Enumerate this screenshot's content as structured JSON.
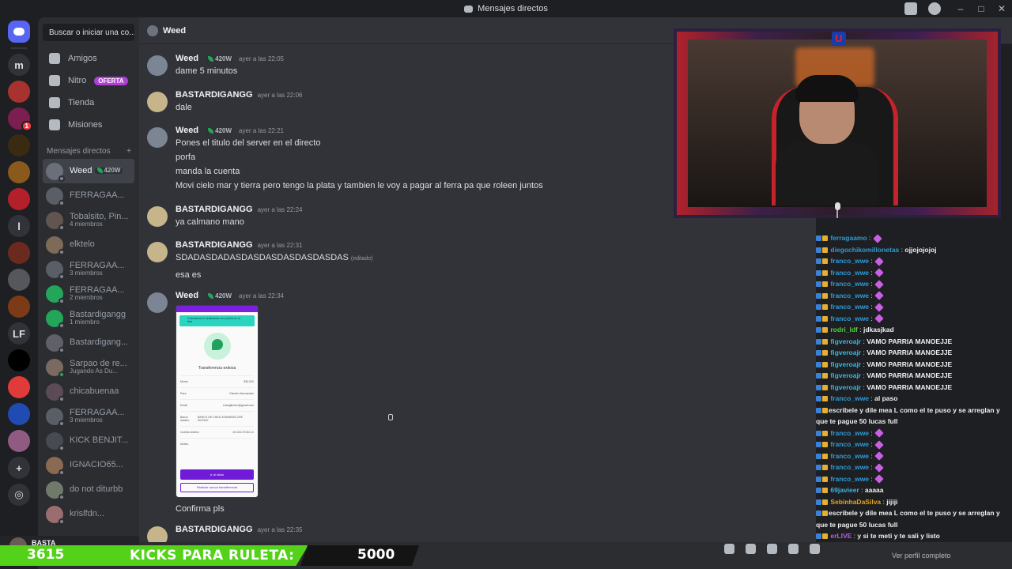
{
  "window": {
    "title": "Mensajes directos"
  },
  "rail": {
    "servers": [
      {
        "label": "",
        "kind": "home",
        "color": "#5865f2"
      },
      {
        "label": "m",
        "kind": "letter",
        "color": "#313338"
      },
      {
        "label": "",
        "kind": "img",
        "color": "#a8322d"
      },
      {
        "label": "",
        "kind": "img",
        "color": "#7a1f4f",
        "badge": "1"
      },
      {
        "label": "",
        "kind": "img",
        "color": "#3a2a12"
      },
      {
        "label": "",
        "kind": "img",
        "color": "#8a5a1c"
      },
      {
        "label": "",
        "kind": "img",
        "color": "#b3202a"
      },
      {
        "label": "l",
        "kind": "letter",
        "color": "#313338"
      },
      {
        "label": "",
        "kind": "img",
        "color": "#6b2a1f"
      },
      {
        "label": "",
        "kind": "img",
        "color": "#55575d"
      },
      {
        "label": "",
        "kind": "img",
        "color": "#7b3b16"
      },
      {
        "label": "LF",
        "kind": "letter",
        "color": "#313338"
      },
      {
        "label": "",
        "kind": "img",
        "color": "#000000"
      },
      {
        "label": "",
        "kind": "img",
        "color": "#e03a3a"
      },
      {
        "label": "",
        "kind": "img",
        "color": "#1f4bb3"
      },
      {
        "label": "",
        "kind": "img",
        "color": "#8f5b82"
      }
    ]
  },
  "sidebar": {
    "search_placeholder": "Buscar o iniciar una co...",
    "nav": [
      {
        "label": "Amigos",
        "icon": "friends-icon"
      },
      {
        "label": "Nitro",
        "icon": "nitro-icon",
        "badge": "OFERTA"
      },
      {
        "label": "Tienda",
        "icon": "shop-icon"
      },
      {
        "label": "Misiones",
        "icon": "quests-icon"
      }
    ],
    "dm_header": "Mensajes directos",
    "dms": [
      {
        "name": "Weed",
        "sub": "",
        "tag": "420W",
        "active": true,
        "color": "#6a6f7a",
        "online": false
      },
      {
        "name": "FERRAGAA...",
        "sub": "",
        "color": "#5a5e66",
        "online": false
      },
      {
        "name": "Tobalsito, Pin...",
        "sub": "4 miembros",
        "color": "#62554f",
        "online": false
      },
      {
        "name": "elktelo",
        "sub": "",
        "color": "#7d6b58",
        "online": false
      },
      {
        "name": "FERRAGAA...",
        "sub": "3 miembros",
        "color": "#5a5e66",
        "online": false
      },
      {
        "name": "FERRAGAA...",
        "sub": "2 miembros",
        "color": "#23a55a",
        "online": false
      },
      {
        "name": "Bastardigangg",
        "sub": "1 miembro",
        "color": "#23a55a",
        "online": false
      },
      {
        "name": "Bastardigang...",
        "sub": "",
        "color": "#5f6068",
        "online": false
      },
      {
        "name": "Sarpao de re...",
        "sub": "Jugando As Du...",
        "color": "#7a6a5f",
        "online": true
      },
      {
        "name": "chicabuenaa",
        "sub": "",
        "color": "#5c4a56",
        "online": false
      },
      {
        "name": "FERRAGAA...",
        "sub": "3 miembros",
        "color": "#5a5e66",
        "online": false
      },
      {
        "name": "KICK BENJIT...",
        "sub": "",
        "color": "#474a50",
        "online": false
      },
      {
        "name": "IGNACIO65...",
        "sub": "",
        "color": "#8a6a52",
        "online": false
      },
      {
        "name": "do not diturbb",
        "sub": "",
        "color": "#6f7a6b",
        "online": false
      },
      {
        "name": "krislfdn...",
        "sub": "",
        "color": "#9a6d70",
        "online": false
      }
    ]
  },
  "chat_header": {
    "name": "Weed"
  },
  "messages": [
    {
      "author": "Weed",
      "tag": "420W",
      "time": "ayer a las 22:05",
      "color": "#7b8593",
      "lines": [
        "dame 5 minutos"
      ]
    },
    {
      "author": "BASTARDIGANGG",
      "tag": "",
      "time": "ayer a las 22:06",
      "color": "#c6b48b",
      "lines": [
        "dale"
      ]
    },
    {
      "author": "Weed",
      "tag": "420W",
      "time": "ayer a las 22:21",
      "color": "#7b8593",
      "lines": [
        "Pones el titulo del server en el directo",
        "porfa",
        "manda la cuenta",
        "Movi cielo mar y tierra pero tengo la plata y tambien le voy a pagar al ferra pa que roleen juntos"
      ]
    },
    {
      "author": "BASTARDIGANGG",
      "tag": "",
      "time": "ayer a las 22:24",
      "color": "#c6b48b",
      "lines": [
        "ya calmano mano"
      ]
    },
    {
      "author": "BASTARDIGANGG",
      "tag": "",
      "time": "ayer a las 22:31",
      "color": "#c6b48b",
      "lines": [
        "SDADASDADASDASDASDASDASDASDAS",
        "esa es"
      ],
      "edited": "(editado)"
    },
    {
      "author": "Weed",
      "tag": "420W",
      "time": "ayer a las 22:34",
      "color": "#7b8593",
      "lines": [],
      "after": "Confirma pls"
    },
    {
      "author": "BASTARDIGANGG",
      "tag": "",
      "time": "ayer a las 22:35",
      "color": "#c6b48b",
      "lines": []
    }
  ],
  "receipt": {
    "banner": "Guardamos el destinatario así podrás en tu lista.",
    "title": "Transferencia exitosa",
    "rows": [
      {
        "k": "Monto",
        "v": "$30.000"
      },
      {
        "k": "Para",
        "v": "Claudio Hermandaz"
      },
      {
        "k": "Email",
        "v": "extragltmero@gmail.com"
      },
      {
        "k": "Banco destino",
        "v": "BANCO DE CHILE-EDWARDS-CRE DICHILE"
      },
      {
        "k": "Cuenta destino",
        "v": "00-024-97242-11"
      },
      {
        "k": "Motivo",
        "v": ""
      }
    ],
    "btn_primary": "Ir al inicio",
    "btn_secondary": "Realizar nueva transferencia"
  },
  "stream_chat": [
    {
      "user": "ferragaamo",
      "msg": "",
      "color": "#2e9bd6",
      "emote": true
    },
    {
      "user": "diegochikomillonetas",
      "msg": "ojjojojojoj",
      "color": "#2e9bd6",
      "emote": false
    },
    {
      "user": "franco_wwe",
      "msg": "",
      "color": "#2e9bd6",
      "emote": true
    },
    {
      "user": "franco_wwe",
      "msg": "",
      "color": "#2e9bd6",
      "emote": true
    },
    {
      "user": "franco_wwe",
      "msg": "",
      "color": "#2e9bd6",
      "emote": true
    },
    {
      "user": "franco_wwe",
      "msg": "",
      "color": "#2e9bd6",
      "emote": true
    },
    {
      "user": "franco_wwe",
      "msg": "",
      "color": "#2e9bd6",
      "emote": true
    },
    {
      "user": "franco_wwe",
      "msg": "",
      "color": "#2e9bd6",
      "emote": true
    },
    {
      "user": "rodri_ldf",
      "msg": "jdkasjkad",
      "color": "#53d23a",
      "emote": false
    },
    {
      "user": "figveroajr",
      "msg": "VAMO PARRIA MANOEJJE",
      "color": "#39b7e0",
      "emote": false
    },
    {
      "user": "figveroajr",
      "msg": "VAMO PARRIA MANOEJJE",
      "color": "#39b7e0",
      "emote": false
    },
    {
      "user": "figveroajr",
      "msg": "VAMO PARRIA MANOEJJE",
      "color": "#39b7e0",
      "emote": false
    },
    {
      "user": "figveroajr",
      "msg": "VAMO PARRIA MANOEJJE",
      "color": "#39b7e0",
      "emote": false
    },
    {
      "user": "figveroajr",
      "msg": "VAMO PARRIA MANOEJJE",
      "color": "#39b7e0",
      "emote": false
    },
    {
      "user": "franco_wwe",
      "msg": "al paso",
      "color": "#2e9bd6",
      "emote": false
    },
    {
      "user": "",
      "msg": "escribele y dile mea L como el te puso y se arreglan y que te pague 50 lucas full",
      "color": "#d23a3a",
      "emote": false
    },
    {
      "user": "franco_wwe",
      "msg": "",
      "color": "#2e9bd6",
      "emote": true
    },
    {
      "user": "franco_wwe",
      "msg": "",
      "color": "#2e9bd6",
      "emote": true
    },
    {
      "user": "franco_wwe",
      "msg": "",
      "color": "#2e9bd6",
      "emote": true
    },
    {
      "user": "franco_wwe",
      "msg": "",
      "color": "#2e9bd6",
      "emote": true
    },
    {
      "user": "franco_wwe",
      "msg": "",
      "color": "#2e9bd6",
      "emote": true
    },
    {
      "user": "69javieer",
      "msg": "aaaaa",
      "color": "#39b7e0",
      "emote": false
    },
    {
      "user": "SebinhaDaSilva",
      "msg": "jijiji",
      "color": "#e3a21a",
      "emote": false
    },
    {
      "user": "",
      "msg": "escribele y dile mea L como el te puso y se arreglan y que te pague 50 lucas full",
      "color": "#d23a3a",
      "emote": false
    },
    {
      "user": "erLIVE",
      "msg": "y si te meti y te sali y listo",
      "color": "#b65ee6",
      "emote": false
    }
  ],
  "footer": {
    "profile_link": "Ver perfil completo",
    "user_name": "BASTA"
  },
  "kicks": {
    "count": "3615",
    "label": "KICKS PARA RULETA:",
    "goal": "5000"
  },
  "colors": {
    "accent": "#5865f2",
    "online": "#23a55a",
    "offer": "#b13fd6",
    "kicks_green": "#54d21a"
  }
}
